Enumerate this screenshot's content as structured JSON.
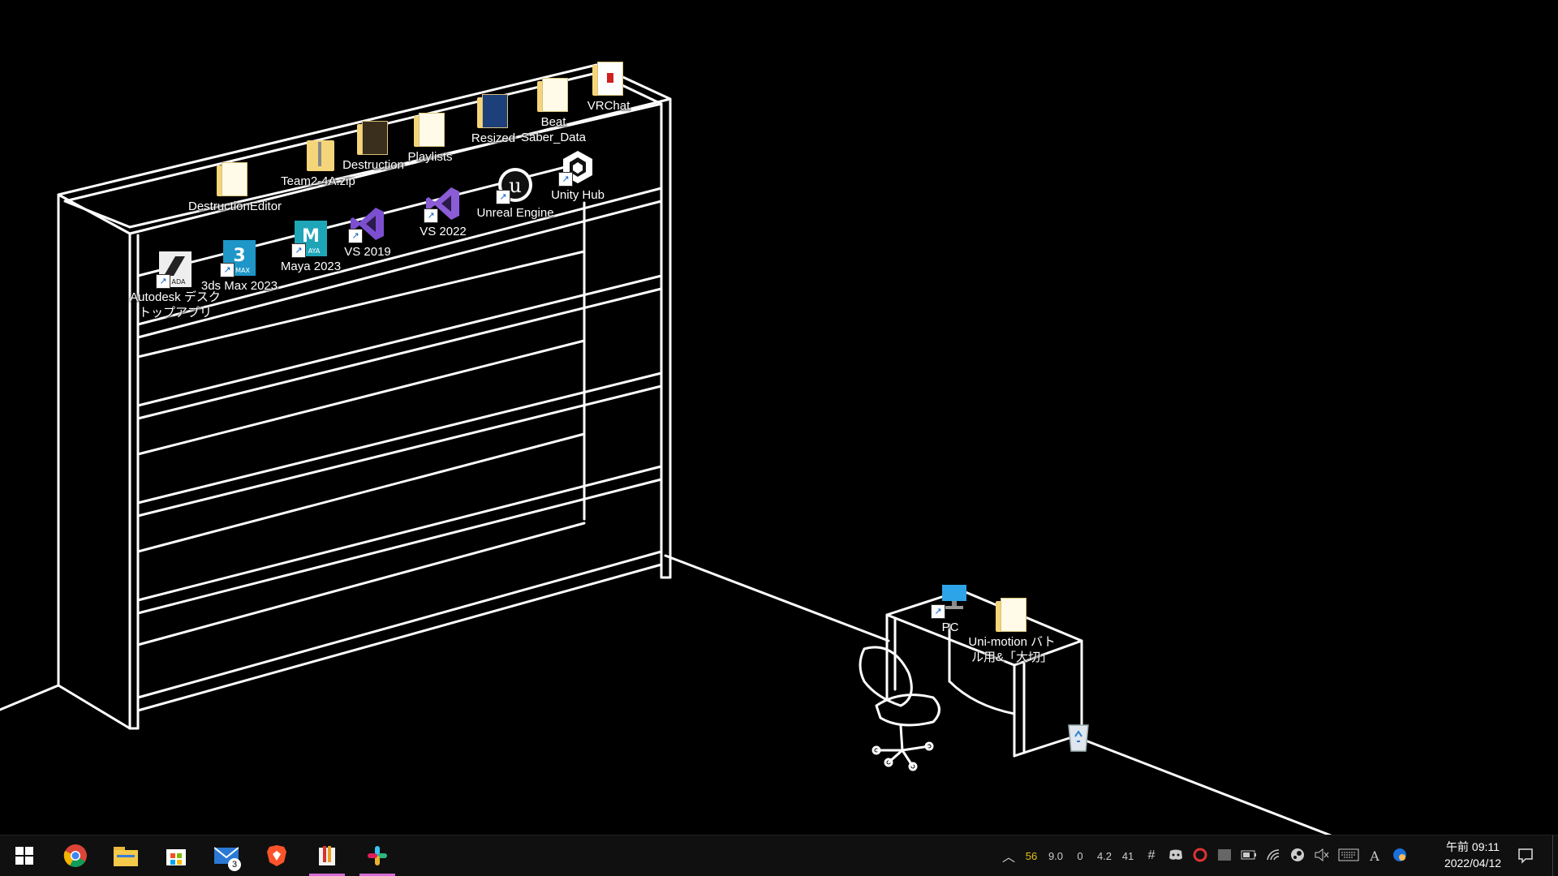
{
  "desktop": {
    "icons": [
      {
        "label": "VRChat",
        "icon": "folder-icon"
      },
      {
        "label": "Beat Saber_Data",
        "icon": "folder-icon"
      },
      {
        "label": "Resized",
        "icon": "folder-icon"
      },
      {
        "label": "Playlists",
        "icon": "folder-icon"
      },
      {
        "label": "Destruction",
        "icon": "folder-icon"
      },
      {
        "label": "Team2-4A.zip",
        "icon": "zip-folder-icon"
      },
      {
        "label": "DestructionEditor",
        "icon": "folder-icon"
      },
      {
        "label": "Unity Hub",
        "icon": "unity-hub-icon"
      },
      {
        "label": "Unreal Engine",
        "icon": "unreal-engine-icon"
      },
      {
        "label": "VS 2022",
        "icon": "visual-studio-icon"
      },
      {
        "label": "VS 2019",
        "icon": "visual-studio-icon"
      },
      {
        "label": "Maya 2023",
        "icon": "maya-icon"
      },
      {
        "label": "3ds Max 2023",
        "icon": "3ds-max-icon"
      },
      {
        "label": "Autodesk デスクトップアプリ",
        "icon": "autodesk-icon"
      },
      {
        "label": "PC",
        "icon": "computer-icon"
      },
      {
        "label": "Uni-motion バトル用&「大切」",
        "icon": "folder-icon"
      },
      {
        "label": "",
        "icon": "recycle-bin-icon"
      }
    ]
  },
  "taskbar": {
    "start_icon": "windows-start-icon",
    "pinned": [
      {
        "icon": "chrome-icon"
      },
      {
        "icon": "file-explorer-icon"
      },
      {
        "icon": "microsoft-store-icon"
      },
      {
        "icon": "mail-icon",
        "badge": "3"
      },
      {
        "icon": "brave-icon"
      },
      {
        "icon": "clip-studio-icon",
        "active": true
      },
      {
        "icon": "slack-icon",
        "active": true
      }
    ],
    "tray": {
      "stats": [
        "56",
        "9.0",
        "0",
        "4.2",
        "41"
      ],
      "stat_colors": [
        "#e8c21a",
        "#cccccc",
        "#cccccc",
        "#cccccc",
        "#cccccc"
      ],
      "ime_label": "A",
      "time": "午前 09:11",
      "date": "2022/04/12"
    },
    "accent_color": "#d46ad6"
  }
}
